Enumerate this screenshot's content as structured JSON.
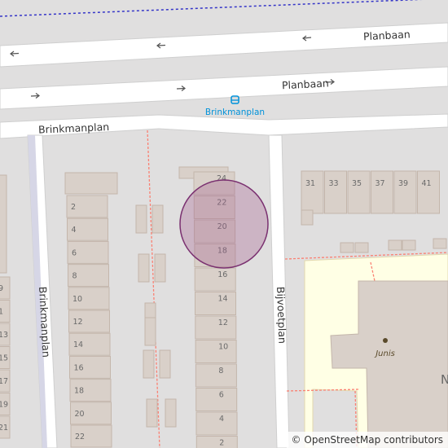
{
  "map": {
    "streets": {
      "planbaan_top": "Planbaan",
      "planbaan_bottom": "Planbaan",
      "brinkmanplan_horizontal": "Brinkmanplan",
      "brinkmanplan_vertical": "Brinkmanplan",
      "bijvoetplan": "Bijvoetplan"
    },
    "bus_stop": {
      "name": "Brinkmanplan",
      "color": "#0092da"
    },
    "poi": {
      "name": "Junis"
    },
    "house_numbers": {
      "left_column": [
        "2",
        "4",
        "6",
        "8",
        "10",
        "12",
        "14",
        "16",
        "18",
        "20",
        "22"
      ],
      "far_left": [
        "9",
        "1",
        "13",
        "15",
        "17",
        "19",
        "21"
      ],
      "center_column": [
        "24",
        "22",
        "20",
        "18",
        "16",
        "14",
        "12",
        "10",
        "8",
        "6",
        "4",
        "2"
      ],
      "right_row": [
        "31",
        "33",
        "35",
        "37",
        "39",
        "41"
      ]
    },
    "marker": {
      "type": "circle",
      "fill": "#a35a8c",
      "stroke": "#7a3070"
    },
    "colors": {
      "background": "#e0dfdf",
      "road": "#ffffff",
      "building": "#d9d0c9",
      "building_outline": "#c4b6ab",
      "school_area": "#ffffe5",
      "footpath": "#fa8072",
      "boundary": "#0000cc"
    }
  },
  "attribution": {
    "symbol": "©",
    "text": "OpenStreetMap contributors"
  }
}
